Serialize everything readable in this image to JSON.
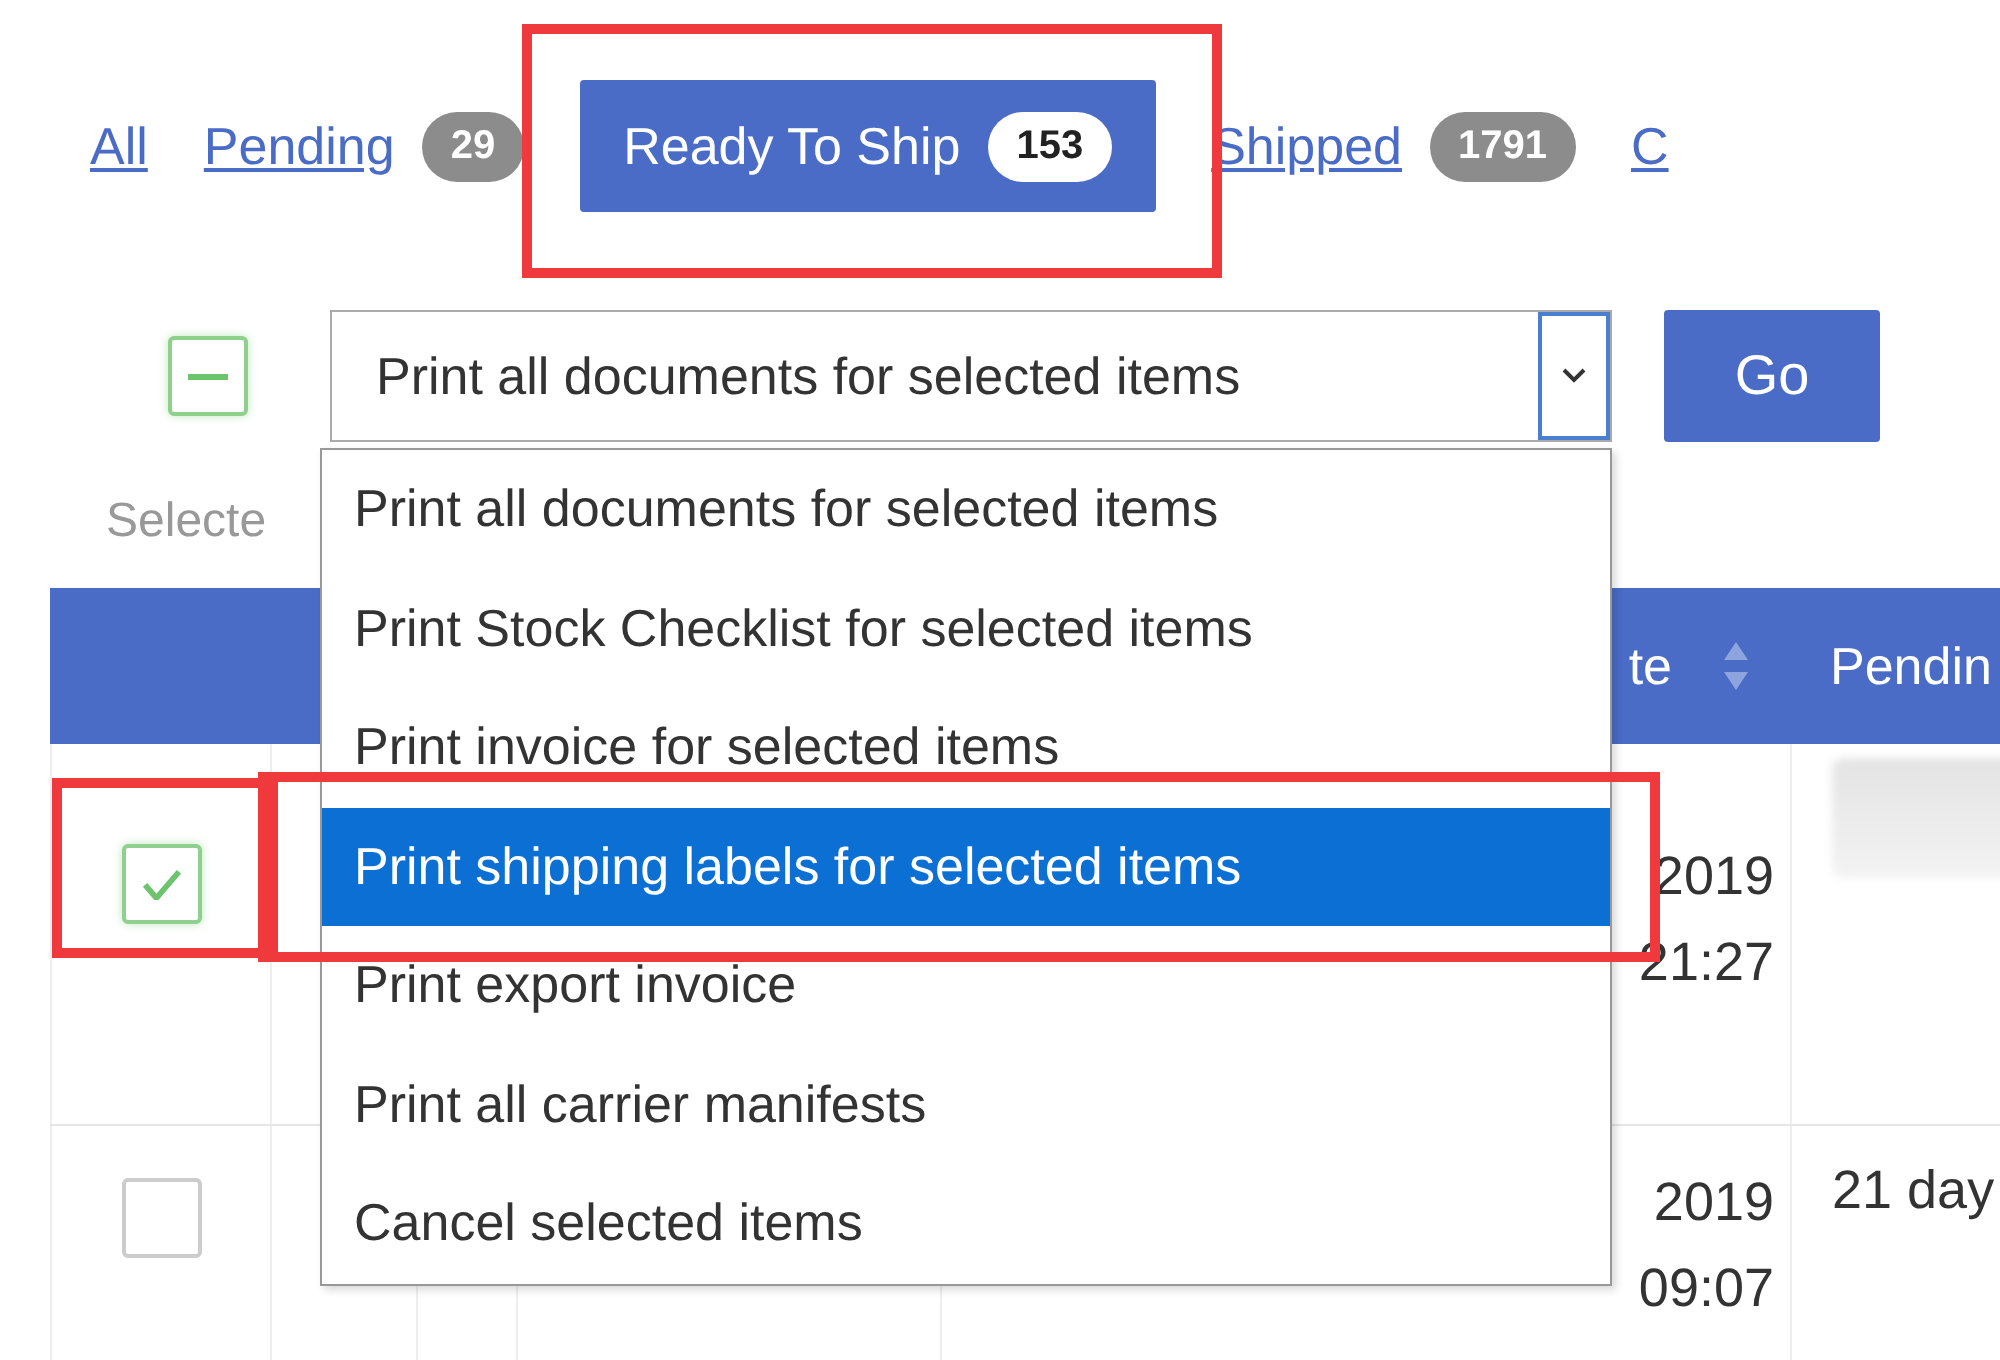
{
  "tabs": [
    {
      "label": "All",
      "selected": false,
      "highlighted": false
    },
    {
      "label": "Pending",
      "count": "29",
      "selected": false,
      "highlighted": false
    },
    {
      "label": "Ready To Ship",
      "count": "153",
      "selected": true,
      "highlighted": true
    },
    {
      "label": "Shipped",
      "count": "1791",
      "selected": false,
      "highlighted": false
    },
    {
      "label": "C",
      "selected": false,
      "highlighted": false
    }
  ],
  "bulk_actions": {
    "select_all": {
      "indeterminate": true
    },
    "action_select": {
      "value": "Print all documents for selected items",
      "expanded": true
    },
    "go_button": "Go",
    "selected_label": "Selecte",
    "options": [
      {
        "label": "Print all documents for selected items",
        "selected": false,
        "highlighted": false
      },
      {
        "label": "Print Stock Checklist for selected items",
        "selected": false,
        "highlighted": false
      },
      {
        "label": "Print invoice for selected items",
        "selected": false,
        "highlighted": false
      },
      {
        "label": "Print shipping labels for selected items",
        "selected": true,
        "highlighted": true
      },
      {
        "label": "Print export invoice",
        "selected": false,
        "highlighted": false
      },
      {
        "label": "Print all carrier manifests",
        "selected": false,
        "highlighted": false
      },
      {
        "label": "Cancel selected items",
        "selected": false,
        "highlighted": false
      }
    ]
  },
  "table": {
    "header": {
      "column_5": "te",
      "column_5_sortable": true,
      "column_6": "Pendin"
    },
    "rows": [
      {
        "checked": true,
        "highlighted": true,
        "column_5": [
          "2019",
          "21:27"
        ],
        "column_6": {
          "kind": "blurred"
        }
      },
      {
        "checked": false,
        "highlighted": false,
        "column_5": [
          "2019",
          "09:07"
        ],
        "column_6": {
          "kind": "text",
          "text": "21 day"
        }
      }
    ]
  }
}
